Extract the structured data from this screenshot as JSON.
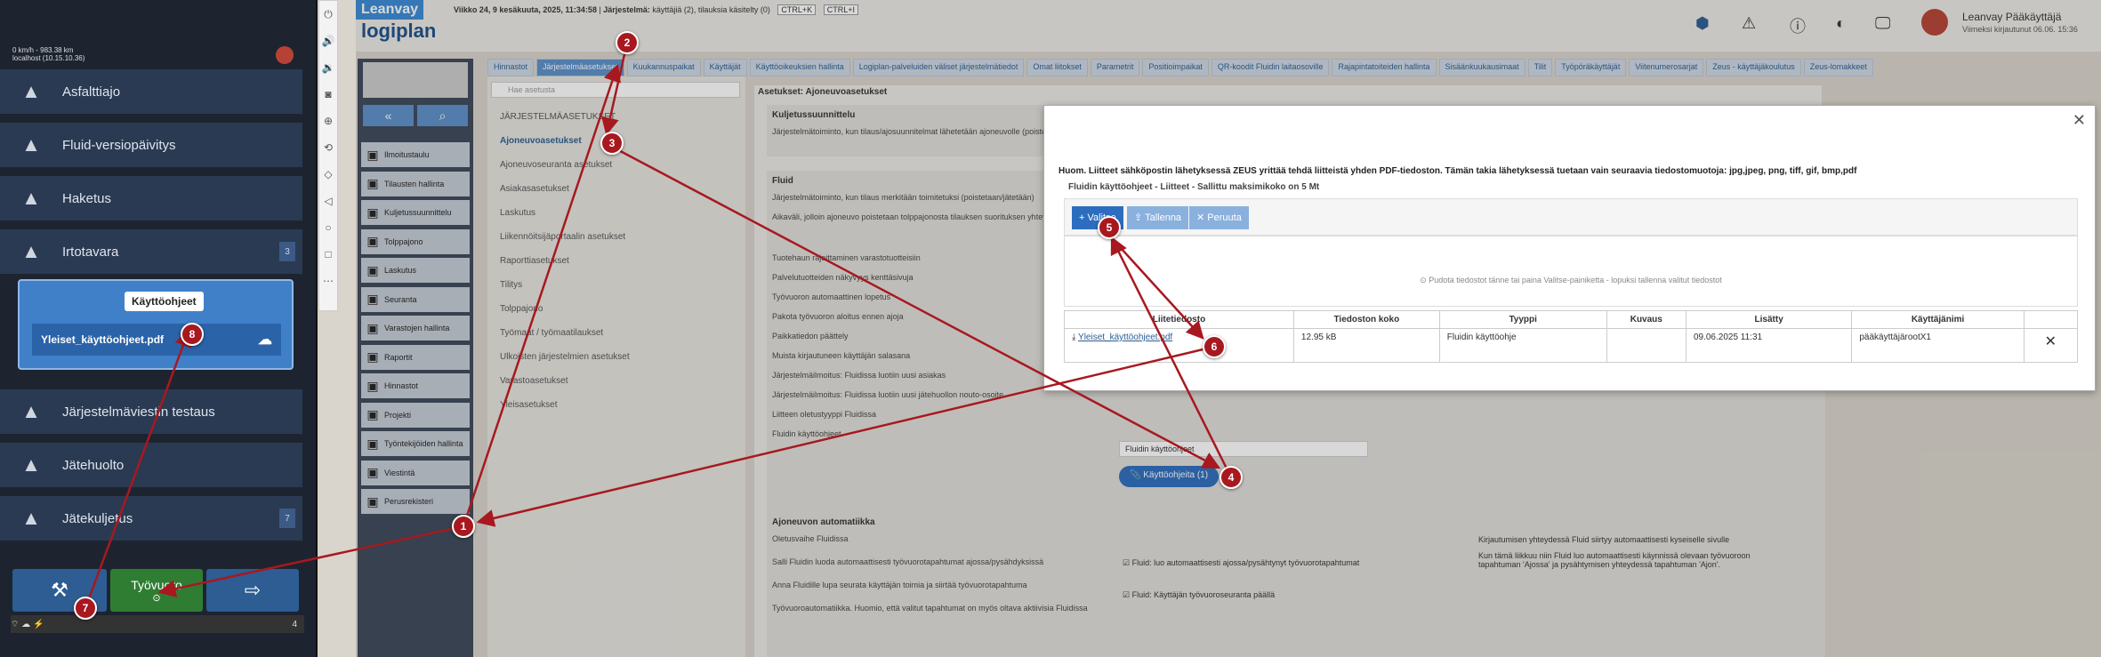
{
  "phone": {
    "status_line1": "0 km/h - 983.38 km",
    "status_line2": "localhost (10.15.10.36)",
    "menu": [
      {
        "label": "Asfalttiajo",
        "icon": "road-icon"
      },
      {
        "label": "Fluid-versiopäivitys",
        "icon": "download-icon"
      },
      {
        "label": "Haketus",
        "icon": "trees-icon"
      },
      {
        "label": "Irtotavara",
        "icon": "pile-icon",
        "badge": "3"
      },
      {
        "label": "Järjestelmäviestin testaus",
        "icon": "megaphone-icon"
      },
      {
        "label": "Jätehuolto",
        "icon": "recycle-icon"
      },
      {
        "label": "Jätekuljetus",
        "icon": "truck-icon",
        "badge": "7"
      }
    ],
    "popup_title": "Käyttöohjeet",
    "popup_file": "Yleiset_käyttöohjeet.pdf",
    "bottom": {
      "shift_label": "Työvuoro"
    },
    "footer_count": "4"
  },
  "app": {
    "logo_top": "Leanvay",
    "logo_main": "logiplan",
    "datetime": "Viikko 24, 9 kesäkuuta, 2025, 11:34:58",
    "system_label": "Järjestelmä:",
    "system_info": "käyttäjiä (2), tilauksia käsitelty (0)",
    "kb1": "CTRL+K",
    "kb2": "CTRL+I",
    "user_name": "Leanvay Pääkäyttäjä",
    "user_sub": "Viimeksi kirjautunut 06.06. 15:36"
  },
  "tabs": [
    "Hinnastot",
    "Järjestelmäasetukset",
    "Kuukannuspaikat",
    "Käyttäjät",
    "Käyttöoikeuksien hallinta",
    "Logiplan-palveluiden väliset järjestelmätiedot",
    "Omat liitokset",
    "Parametrit",
    "Positioimpaikat",
    "QR-koodit Fluidin laitaosoville",
    "Rajapintatoiteiden hallinta",
    "Sisäänkuukausimaat",
    "Tilit",
    "Työpöräkäyttäjät",
    "Viitenumerosarjat",
    "Zeus - käyttäjäkoulutus",
    "Zeus-lomakkeet"
  ],
  "nav": [
    {
      "label": "Ilmoitustaulu",
      "icon": "board-icon"
    },
    {
      "label": "Tilausten hallinta",
      "icon": "list-icon"
    },
    {
      "label": "Kuljetussuunnittelu",
      "icon": "plan-icon"
    },
    {
      "label": "Tolppajono",
      "icon": "grid-icon"
    },
    {
      "label": "Laskutus",
      "icon": "invoice-icon"
    },
    {
      "label": "Seuranta",
      "icon": "search-icon"
    },
    {
      "label": "Varastojen hallinta",
      "icon": "warehouse-icon"
    },
    {
      "label": "Raportit",
      "icon": "report-icon"
    },
    {
      "label": "Hinnastot",
      "icon": "price-icon"
    },
    {
      "label": "Projekti",
      "icon": "project-icon"
    },
    {
      "label": "Työntekijöiden hallinta",
      "icon": "people-icon"
    },
    {
      "label": "Viestintä",
      "icon": "chat-icon"
    },
    {
      "label": "Perusrekisteri",
      "icon": "register-icon"
    }
  ],
  "settings": {
    "search_placeholder": "Hae asetusta",
    "items": [
      "JÄRJESTELMÄASETUKSET",
      "Ajoneuvoasetukset",
      "Ajoneuvoseuranta asetukset",
      "Asiakasasetukset",
      "Laskutus",
      "Liikennöitsijäportaalin asetukset",
      "Raporttiasetukset",
      "Tilitys",
      "Tolppajono",
      "Työmaat / työmaatilaukset",
      "Ulkoisten järjestelmien asetukset",
      "Varastoasetukset",
      "Yleisasetukset"
    ]
  },
  "content": {
    "heading": "Asetukset: Ajoneuvoasetukset",
    "sec1_title": "Kuljetussuunnittelu",
    "sec1_text": "Järjestelmätoiminto, kun tilaus/ajosuunnitelmat lähetetään ajoneuvolle (poistetaan/jätetään tolppajonoon)",
    "sec2_title": "Fluid",
    "sec2_rows": [
      "Järjestelmätoiminto, kun tilaus merkitään toimitetuksi (poistetaan/jätetään)",
      "Aikaväli, jolloin ajoneuvo poistetaan tolppajonosta tilauksen suorituksen yhteydessä",
      "Tuotehaun rajoittaminen varastotuotteisiin",
      "Palvelutuotteiden näkyvyys kenttäsivuja",
      "Työvuoron automaattinen lopetus",
      "Pakota työvuoron aloitus ennen ajoja",
      "Paikkatiedon päättely",
      "Muista kirjautuneen käyttäjän salasana",
      "Järjestelmäilmoitus: Fluidissa luotiin uusi asiakas",
      "Järjestelmäilmoitus: Fluidissa luotiin uusi jätehuollon nouto-osoite",
      "Liitteen oletustyyppi Fluidissa",
      "Fluidin käyttöohjeet"
    ],
    "attach_default": "Fluidin käyttöohjeet",
    "manuals_button": "Käyttöohjeita (1)",
    "sec3_title": "Ajoneuvon automatiikka",
    "sec3_rows": [
      "Oletusvaihe Fluidissa",
      "Salli Fluidin luoda automaattisesti työvuorotapahtumat ajossa/pysähdyksissä",
      "Anna Fluidille lupa seurata käyttäjän toimia ja siirtää työvuorotapahtuma",
      "Työvuoroautomatiikka. Huomio, että valitut tapahtumat on myös oltava aktiivisia Fluidissa"
    ],
    "chk1": "Fluid: luo automaattisesti ajossa/pysähtynyt työvuorotapahtumat",
    "chk2": "Fluid: Käyttäjän työvuoroseuranta päällä",
    "side_note1": "Kirjautumisen yhteydessä Fluid siirtyy automaattisesti kyseiselle sivulle",
    "side_note2": "Kun tämä liikkuu niin Fluid luo automaattisesti käynnissä olevaan työvuoroon tapahtuman 'Ajossa' ja pysähtymisen yhteydessä tapahtuman 'Ajon'."
  },
  "modal": {
    "note": "Huom. Liitteet sähköpostin lähetyksessä ZEUS yrittää tehdä liitteistä yhden PDF-tiedoston. Tämän takia lähetyksessä tuetaan vain seuraavia tiedostomuotoja: jpg,jpeg, png, tiff, gif, bmp,pdf",
    "subtitle": "Fluidin käyttöohjeet - Liitteet - Sallittu maksimikoko on 5 Mt",
    "btn_add": "Valitse",
    "btn_save": "Tallenna",
    "btn_cancel": "Peruuta",
    "dropzone": "Pudota tiedostot tänne tai paina Valitse-painiketta - lopuksi tallenna valitut tiedostot",
    "columns": [
      "Liitetiedosto",
      "Tiedoston koko",
      "Tyyppi",
      "Kuvaus",
      "Lisätty",
      "Käyttäjänimi"
    ],
    "rows": [
      [
        "Yleiset_käyttöohjeet.pdf",
        "12.95 kB",
        "Fluidin käyttöohje",
        "",
        "09.06.2025 11:31",
        "pääkäyttäjärootX1"
      ]
    ]
  },
  "markers": [
    "1",
    "2",
    "3",
    "4",
    "5",
    "6",
    "7",
    "8"
  ],
  "colors": {
    "annotation": "#a8181f",
    "accent": "#2d5d92"
  }
}
